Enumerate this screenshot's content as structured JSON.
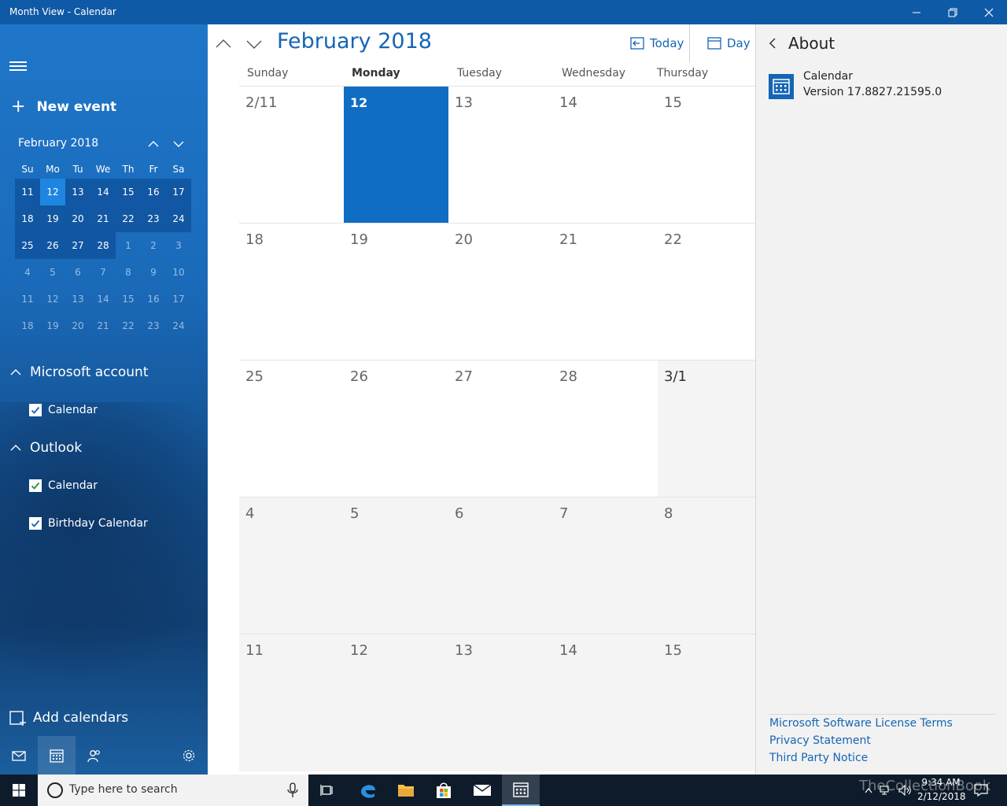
{
  "window": {
    "title": "Month View - Calendar"
  },
  "sidebar": {
    "new_event": "New event",
    "mini_calendar": {
      "title": "February 2018",
      "dow": [
        "Su",
        "Mo",
        "Tu",
        "We",
        "Th",
        "Fr",
        "Sa"
      ],
      "weeks": [
        [
          "11",
          "12",
          "13",
          "14",
          "15",
          "16",
          "17"
        ],
        [
          "18",
          "19",
          "20",
          "21",
          "22",
          "23",
          "24"
        ],
        [
          "25",
          "26",
          "27",
          "28",
          "1",
          "2",
          "3"
        ],
        [
          "4",
          "5",
          "6",
          "7",
          "8",
          "9",
          "10"
        ],
        [
          "11",
          "12",
          "13",
          "14",
          "15",
          "16",
          "17"
        ],
        [
          "18",
          "19",
          "20",
          "21",
          "22",
          "23",
          "24"
        ]
      ],
      "today": "12"
    },
    "accounts": [
      {
        "name": "Microsoft account",
        "calendars": [
          {
            "label": "Calendar",
            "color": "#1565b5"
          }
        ]
      },
      {
        "name": "Outlook",
        "calendars": [
          {
            "label": "Calendar",
            "color": "#2e8b3a"
          },
          {
            "label": "Birthday Calendar",
            "color": "#1565b5"
          }
        ]
      }
    ],
    "add_calendars": "Add calendars"
  },
  "main": {
    "month_title": "February 2018",
    "today_label": "Today",
    "view_label": "Day",
    "days_of_week": [
      "Sunday",
      "Monday",
      "Tuesday",
      "Wednesday",
      "Thursday"
    ],
    "weeks": [
      [
        "2/11",
        "12",
        "13",
        "14",
        "15"
      ],
      [
        "18",
        "19",
        "20",
        "21",
        "22"
      ],
      [
        "25",
        "26",
        "27",
        "28",
        "3/1"
      ],
      [
        "4",
        "5",
        "6",
        "7",
        "8"
      ],
      [
        "11",
        "12",
        "13",
        "14",
        "15"
      ]
    ],
    "accent": "#1565b5",
    "today_color": "#0f6dc4"
  },
  "about": {
    "heading": "About",
    "app_name": "Calendar",
    "version": "Version 17.8827.21595.0",
    "links": [
      "Microsoft Software License Terms",
      "Privacy Statement",
      "Third Party Notice"
    ]
  },
  "taskbar": {
    "search_placeholder": "Type here to search",
    "time": "9:34 AM",
    "date": "2/12/2018",
    "watermark": "TheCollectionBook"
  }
}
